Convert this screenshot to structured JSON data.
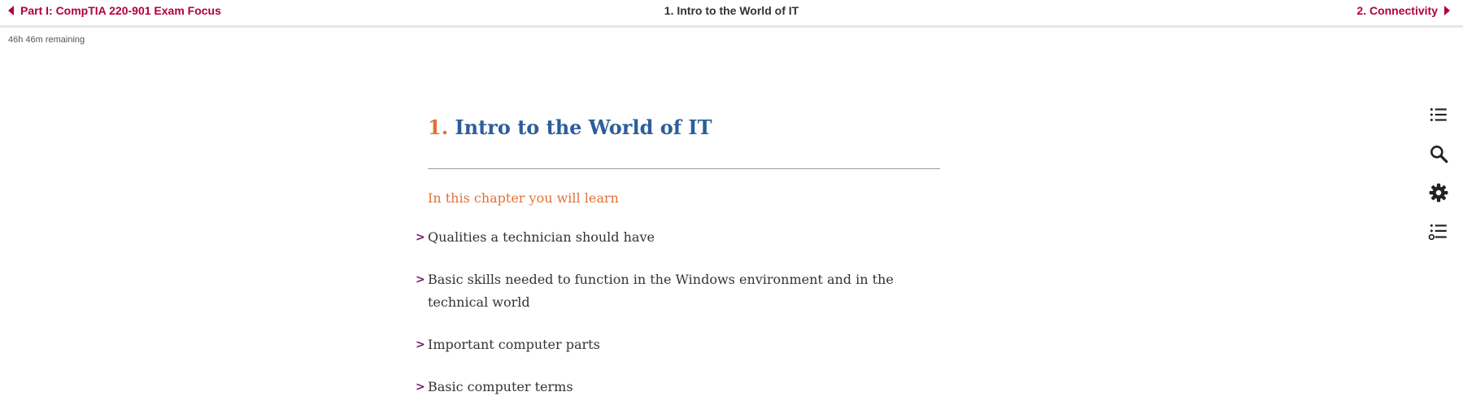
{
  "topbar": {
    "prev_label": "Part I: CompTIA 220-901 Exam Focus",
    "current_label": "1. Intro to the World of IT",
    "next_label": "2. Connectivity"
  },
  "status": {
    "remaining": "46h 46m remaining"
  },
  "chapter": {
    "number": "1.",
    "title": "Intro to the World of IT",
    "learn_heading": "In this chapter you will learn",
    "bullet_glyph": ">",
    "items": [
      "Qualities a technician should have",
      "Basic skills needed to function in the Windows environment and in the technical world",
      "Important computer parts",
      "Basic computer terms"
    ]
  },
  "tools": {
    "icons": [
      "table-of-contents-icon",
      "search-icon",
      "settings-icon",
      "playlist-add-icon"
    ]
  },
  "colors": {
    "accent_nav": "#b3003b",
    "chapter_number": "#e0723a",
    "chapter_title": "#2d5d9a",
    "bullet": "#7a1a5e"
  }
}
